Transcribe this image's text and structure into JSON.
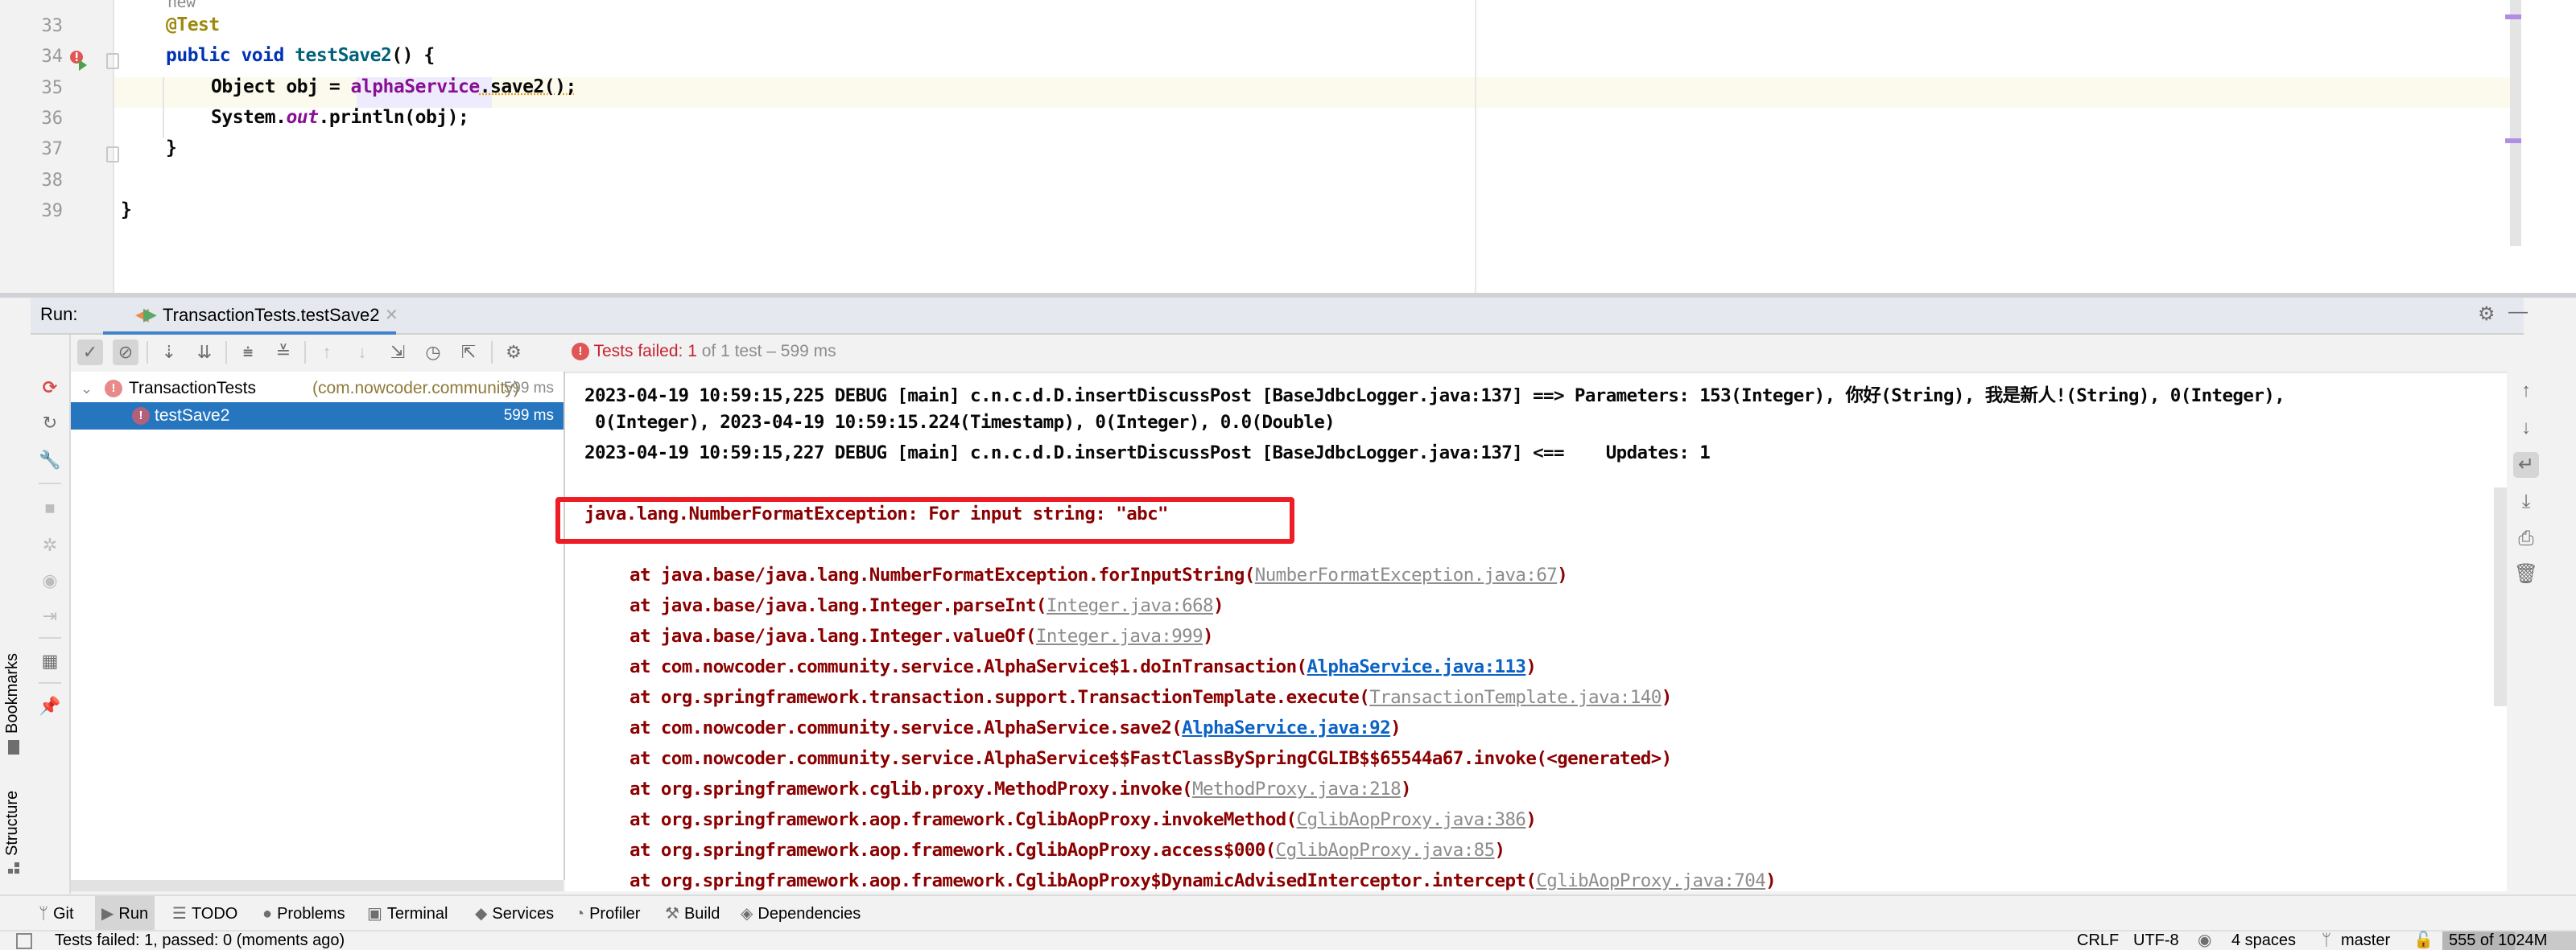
{
  "editor": {
    "hint_above": "new",
    "lines": [
      {
        "num": "33",
        "tokens": [
          {
            "t": "@Test",
            "c": "ann"
          }
        ],
        "indent": 1
      },
      {
        "num": "34",
        "tokens": [
          {
            "t": "public ",
            "c": "kw"
          },
          {
            "t": "void ",
            "c": "kw"
          },
          {
            "t": "testSave2",
            "c": "fn"
          },
          {
            "t": "() {",
            "c": ""
          }
        ],
        "indent": 1
      },
      {
        "num": "35",
        "tokens": [
          {
            "t": "Object obj = ",
            "c": ""
          },
          {
            "t": "alphaService",
            "c": "field"
          },
          {
            "t": ".save2();",
            "c": ""
          }
        ],
        "indent": 2
      },
      {
        "num": "36",
        "tokens": [
          {
            "t": "System.",
            "c": ""
          },
          {
            "t": "out",
            "c": "field-italic"
          },
          {
            "t": ".println(obj);",
            "c": ""
          }
        ],
        "indent": 2
      },
      {
        "num": "37",
        "tokens": [
          {
            "t": "}",
            "c": ""
          }
        ],
        "indent": 1
      },
      {
        "num": "38",
        "tokens": [],
        "indent": 0
      },
      {
        "num": "39",
        "tokens": [
          {
            "t": "}",
            "c": ""
          }
        ],
        "indent": 0
      }
    ]
  },
  "run_panel": {
    "label": "Run:",
    "tab_title": "TransactionTests.testSave2",
    "status_prefix": "Tests failed: ",
    "status_failed": "1",
    "status_suffix": " of 1 test – 599 ms",
    "toolbar_icons": [
      "show-passed-icon",
      "show-ignored-icon",
      "sort-alpha-icon",
      "sort-duration-icon",
      "expand-all-icon",
      "collapse-all-icon",
      "prev-failed-icon",
      "next-failed-icon",
      "import-tests-icon",
      "history-icon",
      "export-icon",
      "settings-icon"
    ],
    "tree": [
      {
        "name": "TransactionTests",
        "package": "(com.nowcoder.community)",
        "time": "599 ms",
        "status": "failed",
        "expanded": true
      },
      {
        "name": "testSave2",
        "package": "",
        "time": "599 ms",
        "status": "failed",
        "selected": true
      }
    ]
  },
  "console": {
    "lines": [
      {
        "type": "plain",
        "text": "2023-04-19 10:59:15,225 DEBUG [main] c.n.c.d.D.insertDiscussPost [BaseJdbcLogger.java:137] ==> Parameters: 153(Integer), 你好(String), 我是新人!(String), 0(Integer),"
      },
      {
        "type": "plain",
        "text": " 0(Integer), 2023-04-19 10:59:15.224(Timestamp), 0(Integer), 0.0(Double)"
      },
      {
        "type": "plain",
        "text": "2023-04-19 10:59:15,227 DEBUG [main] c.n.c.d.D.insertDiscussPost [BaseJdbcLogger.java:137] <==    Updates: 1"
      },
      {
        "type": "blank",
        "text": ""
      },
      {
        "type": "exception",
        "text": "java.lang.NumberFormatException: For input string: \"abc\""
      },
      {
        "type": "blank",
        "text": ""
      }
    ],
    "stack": [
      {
        "prefix": "at java.base/java.lang.NumberFormatException.forInputString(",
        "link": "NumberFormatException.java:67",
        "link_style": "grey",
        "suffix": ")"
      },
      {
        "prefix": "at java.base/java.lang.Integer.parseInt(",
        "link": "Integer.java:668",
        "link_style": "grey",
        "suffix": ")"
      },
      {
        "prefix": "at java.base/java.lang.Integer.valueOf(",
        "link": "Integer.java:999",
        "link_style": "grey",
        "suffix": ")"
      },
      {
        "prefix": "at com.nowcoder.community.service.AlphaService$1.doInTransaction(",
        "link": "AlphaService.java:113",
        "link_style": "blue",
        "suffix": ")"
      },
      {
        "prefix": "at org.springframework.transaction.support.TransactionTemplate.execute(",
        "link": "TransactionTemplate.java:140",
        "link_style": "grey",
        "suffix": ")"
      },
      {
        "prefix": "at com.nowcoder.community.service.AlphaService.save2(",
        "link": "AlphaService.java:92",
        "link_style": "blue",
        "suffix": ")"
      },
      {
        "prefix": "at com.nowcoder.community.service.AlphaService$$FastClassBySpringCGLIB$$65544a67.invoke(<generated>)",
        "link": "",
        "link_style": "",
        "suffix": ""
      },
      {
        "prefix": "at org.springframework.cglib.proxy.MethodProxy.invoke(",
        "link": "MethodProxy.java:218",
        "link_style": "grey",
        "suffix": ")"
      },
      {
        "prefix": "at org.springframework.aop.framework.CglibAopProxy.invokeMethod(",
        "link": "CglibAopProxy.java:386",
        "link_style": "grey",
        "suffix": ")"
      },
      {
        "prefix": "at org.springframework.aop.framework.CglibAopProxy.access$000(",
        "link": "CglibAopProxy.java:85",
        "link_style": "grey",
        "suffix": ")"
      },
      {
        "prefix": "at org.springframework.aop.framework.CglibAopProxy$DynamicAdvisedInterceptor.intercept(",
        "link": "CglibAopProxy.java:704",
        "link_style": "grey",
        "suffix": ")"
      }
    ],
    "highlight_color": "#ee1c25"
  },
  "side_labels": {
    "bookmarks": "Bookmarks",
    "structure": "Structure"
  },
  "bottom_tools": [
    {
      "label": "Git",
      "icon": "git-branch-icon",
      "glyph": "ᛘ"
    },
    {
      "label": "Run",
      "icon": "run-icon",
      "glyph": "▶",
      "active": true
    },
    {
      "label": "TODO",
      "icon": "todo-list-icon",
      "glyph": "☰"
    },
    {
      "label": "Problems",
      "icon": "problems-icon",
      "glyph": "●"
    },
    {
      "label": "Terminal",
      "icon": "terminal-icon",
      "glyph": "▣"
    },
    {
      "label": "Services",
      "icon": "services-icon",
      "glyph": "◆"
    },
    {
      "label": "Profiler",
      "icon": "profiler-icon",
      "glyph": "◔"
    },
    {
      "label": "Build",
      "icon": "build-hammer-icon",
      "glyph": "⚒"
    },
    {
      "label": "Dependencies",
      "icon": "dependencies-icon",
      "glyph": "◈"
    }
  ],
  "status_bar": {
    "message": "Tests failed: 1, passed: 0 (moments ago)",
    "line_separator": "CRLF",
    "encoding": "UTF-8",
    "indent": "4 spaces",
    "branch": "master",
    "memory": "555 of 1024M",
    "memory_used_fraction": 0.54
  },
  "colors": {
    "accent": "#2675bf",
    "error_text": "#8b0000",
    "failed_red": "#c7222d",
    "link_blue": "#0b63c4"
  }
}
